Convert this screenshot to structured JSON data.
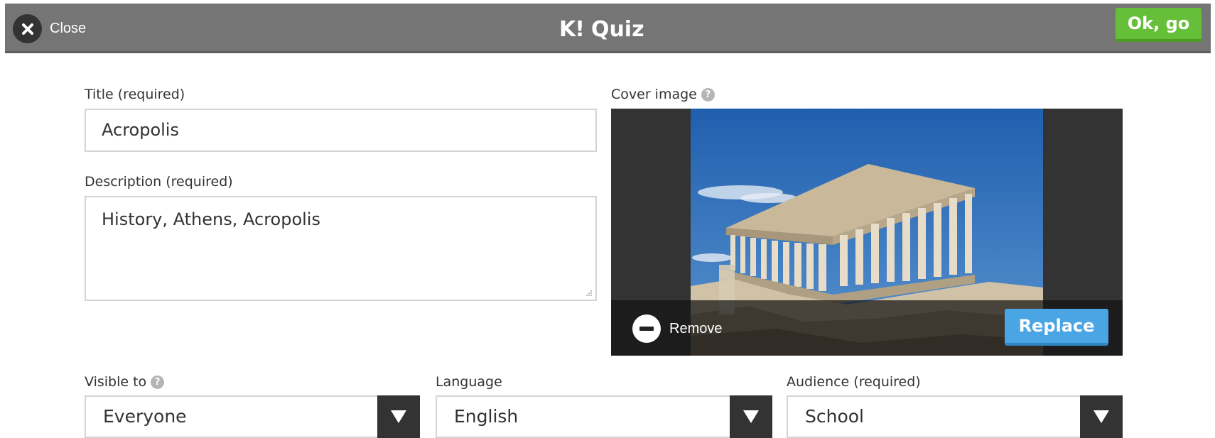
{
  "header": {
    "close_label": "Close",
    "logo_text": "K!",
    "title": "Quiz",
    "ok_label": "Ok, go"
  },
  "form": {
    "title_label": "Title (required)",
    "title_value": "Acropolis",
    "description_label": "Description (required)",
    "description_value": "History, Athens, Acropolis",
    "cover_label": "Cover image",
    "remove_label": "Remove",
    "replace_label": "Replace",
    "visible_label": "Visible to",
    "visible_value": "Everyone",
    "language_label": "Language",
    "language_value": "English",
    "audience_label": "Audience (required)",
    "audience_value": "School",
    "help_glyph": "?"
  },
  "colors": {
    "topbar": "#757575",
    "ok_button": "#66bf39",
    "replace_button": "#4aa5e4",
    "dark": "#333333"
  },
  "icons": [
    "close-icon",
    "help-icon",
    "remove-icon",
    "dropdown-arrow-icon"
  ]
}
